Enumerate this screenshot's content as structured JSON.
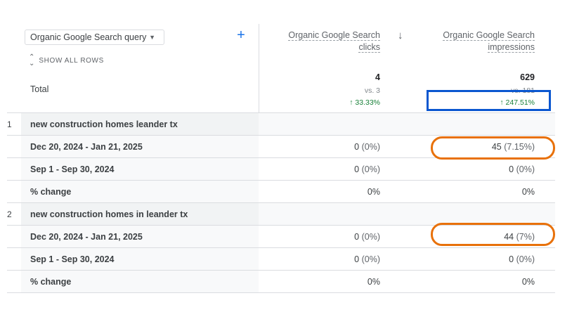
{
  "toolbar": {
    "dimension_select": "Organic Google Search query",
    "show_all_rows": "SHOW ALL ROWS"
  },
  "columns": {
    "clicks_header": "Organic Google Search clicks",
    "impressions_header": "Organic Google Search impressions"
  },
  "totals": {
    "label": "Total",
    "clicks_value": "4",
    "clicks_vs": "vs. 3",
    "clicks_change": "↑ 33.33%",
    "impressions_value": "629",
    "impressions_vs": "vs. 181",
    "impressions_change": "↑ 247.51%"
  },
  "groups": [
    {
      "rank": "1",
      "query": "new construction homes leander tx",
      "rows": [
        {
          "label": "Dec 20, 2024 - Jan 21, 2025",
          "clicks": "0",
          "clicks_pct": "(0%)",
          "impressions": "45",
          "impressions_pct": "(7.15%)"
        },
        {
          "label": "Sep 1 - Sep 30, 2024",
          "clicks": "0",
          "clicks_pct": "(0%)",
          "impressions": "0",
          "impressions_pct": "(0%)"
        },
        {
          "label": "% change",
          "clicks": "0%",
          "clicks_pct": "",
          "impressions": "0%",
          "impressions_pct": ""
        }
      ]
    },
    {
      "rank": "2",
      "query": "new construction homes in leander tx",
      "rows": [
        {
          "label": "Dec 20, 2024 - Jan 21, 2025",
          "clicks": "0",
          "clicks_pct": "(0%)",
          "impressions": "44",
          "impressions_pct": "(7%)"
        },
        {
          "label": "Sep 1 - Sep 30, 2024",
          "clicks": "0",
          "clicks_pct": "(0%)",
          "impressions": "0",
          "impressions_pct": "(0%)"
        },
        {
          "label": "% change",
          "clicks": "0%",
          "clicks_pct": "",
          "impressions": "0%",
          "impressions_pct": ""
        }
      ]
    }
  ],
  "colors": {
    "accent": "#1a73e8",
    "positive": "#188038",
    "annotation_blue": "#0b57d0",
    "annotation_orange": "#e8710a"
  }
}
